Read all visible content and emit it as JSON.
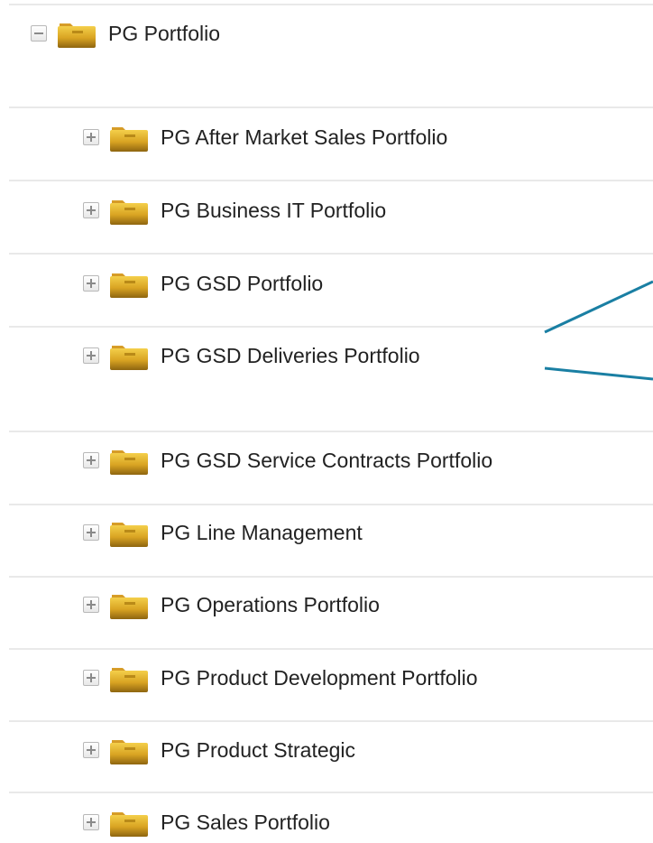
{
  "tree": {
    "root": {
      "label": "PG Portfolio",
      "expanded": true
    },
    "children": [
      {
        "label": "PG After Market Sales Portfolio",
        "expanded": false
      },
      {
        "label": "PG Business IT Portfolio",
        "expanded": false
      },
      {
        "label": "PG GSD Portfolio",
        "expanded": false
      },
      {
        "label": "PG GSD Deliveries Portfolio",
        "expanded": false
      },
      {
        "label": "PG GSD Service Contracts Portfolio",
        "expanded": false
      },
      {
        "label": "PG Line Management",
        "expanded": false
      },
      {
        "label": "PG Operations Portfolio",
        "expanded": false
      },
      {
        "label": "PG Product Development Portfolio",
        "expanded": false
      },
      {
        "label": "PG Product Strategic",
        "expanded": false
      },
      {
        "label": "PG Sales Portfolio",
        "expanded": false
      }
    ]
  },
  "icons": {
    "collapse": "minus-box-icon",
    "expand": "plus-box-icon",
    "folder": "folder-icon"
  },
  "colors": {
    "folder": "#d8a322",
    "connector_line": "#1a7fa3",
    "separator": "#e9e9e9"
  }
}
